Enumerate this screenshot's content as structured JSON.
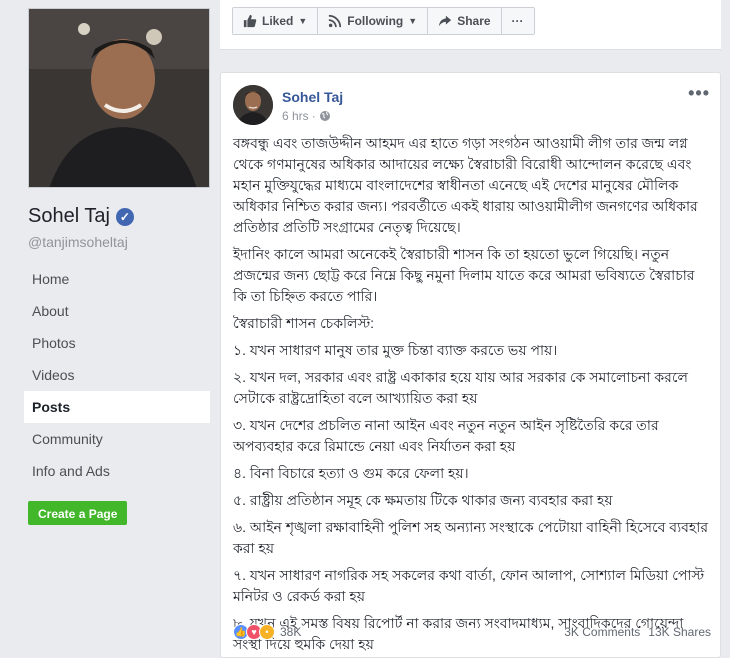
{
  "profile": {
    "name": "Sohel Taj",
    "handle": "@tanjimsoheltaj"
  },
  "nav": {
    "items": [
      {
        "label": "Home",
        "active": false
      },
      {
        "label": "About",
        "active": false
      },
      {
        "label": "Photos",
        "active": false
      },
      {
        "label": "Videos",
        "active": false
      },
      {
        "label": "Posts",
        "active": true
      },
      {
        "label": "Community",
        "active": false
      },
      {
        "label": "Info and Ads",
        "active": false
      }
    ],
    "create_page_label": "Create a Page"
  },
  "action_bar": {
    "liked_label": "Liked",
    "following_label": "Following",
    "share_label": "Share",
    "more_label": "···"
  },
  "post": {
    "author": "Sohel Taj",
    "time": "6 hrs",
    "more_label": "•••",
    "paragraphs": [
      "বঙ্গবন্ধু এবং তাজউদ্দীন আহমদ এর হাতে গড়া সংগঠন আওয়ামী লীগ তার জন্ম লগ্ন থেকে গণমানুষের অধিকার আদায়ের লক্ষ্যে স্বৈরাচারী বিরোধী আন্দোলন করেছে এবং মহান মুক্তিযুদ্ধের মাধ্যমে বাংলাদেশের স্বাধীনতা এনেছে এই দেশের মানুষের মৌলিক অধিকার নিশ্চিত করার জন্য। পরবর্তীতে একই ধারায় আওয়ামীলীগ জনগণের অধিকার প্রতিষ্ঠার প্রতিটি সংগ্রামের নেতৃত্ব দিয়েছে।",
      "ইদানিং কালে আমরা অনেকেই স্বৈরাচারী শাসন কি তা হয়তো ভুলে গিয়েছি। নতুন প্রজন্মের জন্য ছোট্ট করে নিম্নে কিছু নমুনা দিলাম যাতে করে আমরা ভবিষ্যতে স্বৈরাচার কি তা চিহ্নিত করতে পারি।",
      "স্বৈরাচারী শাসন চেকলিস্ট:",
      "১. যখন সাধারণ মানুষ তার মুক্ত চিন্তা ব্যাক্ত করতে ভয় পায়।",
      "২. যখন দল, সরকার এবং রাষ্ট্র একাকার হয়ে যায় আর সরকার কে সমালোচনা করলে সেটাকে রাষ্ট্রদ্রোহিতা বলে আখ্যায়িত করা হয়",
      "৩. যখন দেশের প্রচলিত নানা আইন এবং নতুন নতুন আইন সৃষ্টিতৈরি করে তার অপব্যবহার করে রিমান্ডে নেয়া এবং নির্যাতন করা হয়",
      "৪. বিনা বিচারে হত্যা ও গুম করে ফেলা হয়।",
      "৫. রাষ্ট্রীয় প্রতিষ্ঠান সমূহ কে ক্ষমতায় টিকে থাকার জন্য ব্যবহার করা হয়",
      "৬. আইন শৃঙ্খলা রক্ষাবাহিনী পুলিশ সহ অন্যান্য সংস্থাকে পেটোয়া বাহিনী হিসেবে ব্যবহার করা হয়",
      "৭. যখন সাধারণ নাগরিক সহ সকলের কথা বার্তা, ফোন আলাপ, সোশ্যাল মিডিয়া পোস্ট মনিটর ও রেকর্ড করা হয়",
      "৮. যখন এই সমস্ত বিষয় রিপোর্ট না করার জন্য সংবাদমাধ্যম, সাংবাদিকদের গোয়েন্দা সংস্থা দিয়ে হুমকি দেয়া হয়"
    ],
    "reactions_count": "38K",
    "comments": "3K Comments",
    "shares": "13K Shares"
  },
  "colors": {
    "link": "#365899",
    "accent": "#4267b2",
    "green": "#42b72a",
    "background": "#e9ebee"
  }
}
